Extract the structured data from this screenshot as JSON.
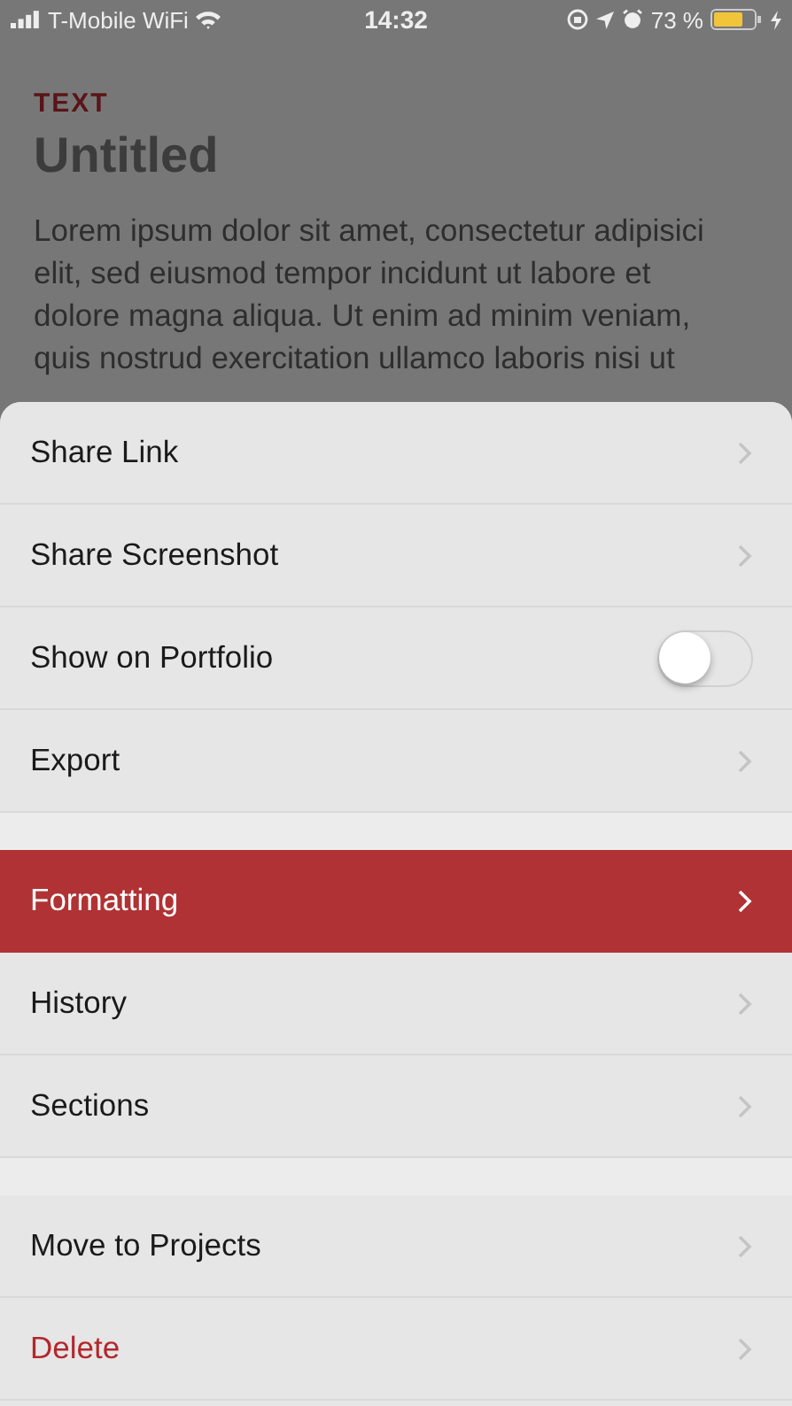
{
  "status_bar": {
    "carrier": "T-Mobile WiFi",
    "time": "14:32",
    "battery": "73 %"
  },
  "document": {
    "label": "TEXT",
    "title": "Untitled",
    "body": "Lorem ipsum dolor sit amet, consectetur adipisici elit, sed eiusmod tempor incidunt ut labore et dolore magna aliqua. Ut enim ad minim veniam, quis nostrud exercitation ullamco laboris nisi ut"
  },
  "menu": {
    "groups": [
      {
        "items": [
          {
            "label": "Share Link",
            "kind": "link",
            "selected": false
          },
          {
            "label": "Share Screenshot",
            "kind": "link",
            "selected": false
          },
          {
            "label": "Show on Portfolio",
            "kind": "toggle",
            "on": false,
            "selected": false
          },
          {
            "label": "Export",
            "kind": "link",
            "selected": false
          }
        ]
      },
      {
        "items": [
          {
            "label": "Formatting",
            "kind": "link",
            "selected": true
          },
          {
            "label": "History",
            "kind": "link",
            "selected": false
          },
          {
            "label": "Sections",
            "kind": "link",
            "selected": false
          }
        ]
      },
      {
        "items": [
          {
            "label": "Move to Projects",
            "kind": "link",
            "selected": false
          },
          {
            "label": "Delete",
            "kind": "danger",
            "selected": false
          }
        ]
      }
    ]
  }
}
